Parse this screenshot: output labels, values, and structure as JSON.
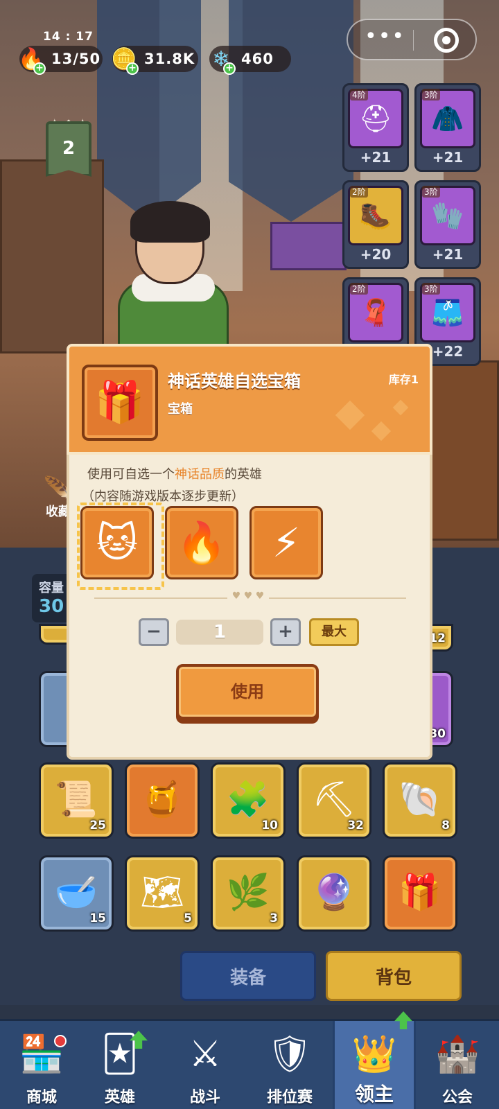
{
  "status": {
    "time": "14 : 17"
  },
  "resources": [
    {
      "icon": "flame-icon",
      "glyph": "🔥",
      "value": "13/50"
    },
    {
      "icon": "gold-coin-icon",
      "glyph": "🪙",
      "value": "31.8K"
    },
    {
      "icon": "crystal-icon",
      "glyph": "❄",
      "value": "460"
    }
  ],
  "capsule": {
    "more": "•••"
  },
  "lord_level": "2",
  "equipment": [
    {
      "tier": "4阶",
      "glyph": "⛑",
      "color": "purple",
      "bonus": "+21"
    },
    {
      "tier": "3阶",
      "glyph": "🧥",
      "color": "purple",
      "bonus": "+21"
    },
    {
      "tier": "2阶",
      "glyph": "🥾",
      "color": "gold",
      "bonus": "+20"
    },
    {
      "tier": "3阶",
      "glyph": "🧤",
      "color": "purple",
      "bonus": "+21"
    },
    {
      "tier": "2阶",
      "glyph": "🧣",
      "color": "purple",
      "bonus": ""
    },
    {
      "tier": "3阶",
      "glyph": "🩳",
      "color": "purple",
      "bonus": "+22"
    }
  ],
  "collect_label": "收藏",
  "capacity": {
    "label": "容量",
    "value": "30"
  },
  "partial_counts": {
    "right_top": "12",
    "right_mid": "30"
  },
  "inventory": [
    {
      "glyph": "📜",
      "color": "gold",
      "count": "25"
    },
    {
      "glyph": "🍯",
      "color": "orange",
      "count": ""
    },
    {
      "glyph": "🧩",
      "color": "gold",
      "count": "10"
    },
    {
      "glyph": "⛏",
      "color": "gold",
      "count": "32"
    },
    {
      "glyph": "🐚",
      "color": "gold",
      "count": "8"
    },
    {
      "glyph": "🥣",
      "color": "blue",
      "count": "15"
    },
    {
      "glyph": "🗺",
      "color": "gold",
      "count": "5"
    },
    {
      "glyph": "🌿",
      "color": "gold",
      "count": "3"
    },
    {
      "glyph": "🔮",
      "color": "gold",
      "count": ""
    },
    {
      "glyph": "🎁",
      "color": "orange",
      "count": ""
    }
  ],
  "tabs": {
    "equip": "装备",
    "bag": "背包"
  },
  "nav": [
    {
      "label": "商城",
      "icon": "shop-icon",
      "glyph": "🏪"
    },
    {
      "label": "英雄",
      "icon": "hero-card-icon",
      "glyph": "🃏"
    },
    {
      "label": "战斗",
      "icon": "crossed-swords-icon",
      "glyph": "⚔"
    },
    {
      "label": "排位赛",
      "icon": "ranking-shield-icon",
      "glyph": "🛡"
    },
    {
      "label": "领主",
      "icon": "lord-banner-icon",
      "glyph": "👑"
    },
    {
      "label": "公会",
      "icon": "guild-castle-icon",
      "glyph": "🏰"
    }
  ],
  "modal": {
    "title": "神话英雄自选宝箱",
    "subtitle": "宝箱",
    "stock": "库存1",
    "desc_pre": "使用可自选一个",
    "desc_highlight": "神话品质",
    "desc_post": "的英雄",
    "desc_note": "（内容随游戏版本逐步更新）",
    "heroes": [
      {
        "icon": "hero-cat-girl-icon",
        "glyph": "🐱"
      },
      {
        "icon": "hero-purple-flame-icon",
        "glyph": "🔥"
      },
      {
        "icon": "hero-lightning-knight-icon",
        "glyph": "⚡"
      }
    ],
    "minus": "−",
    "plus": "+",
    "quantity": "1",
    "max_label": "最大",
    "use_label": "使用",
    "chest_glyph": "🎁"
  },
  "colors": {
    "accent": "#ee9a45",
    "highlight": "#e8842a",
    "nav_bg": "#2d4870"
  }
}
